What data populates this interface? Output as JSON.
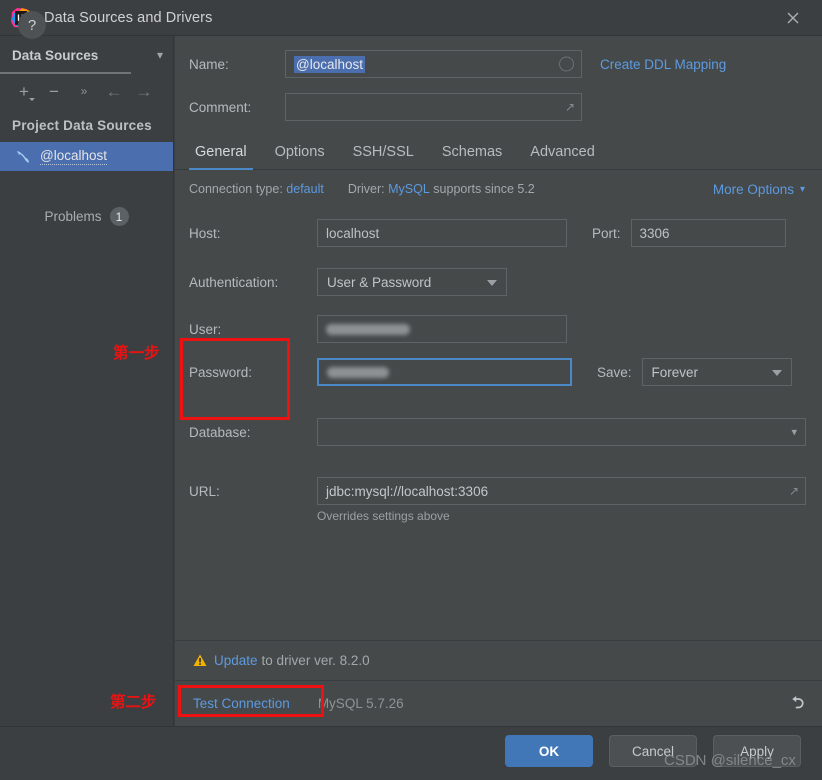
{
  "window": {
    "title": "Data Sources and Drivers",
    "app_icon": "intellij-idea-icon",
    "close_icon": "close-icon"
  },
  "sidebar": {
    "header": {
      "label": "Data Sources",
      "chevron_icon": "chevron-down-icon"
    },
    "toolbar": [
      {
        "name": "add-button",
        "glyph": "+"
      },
      {
        "name": "remove-button",
        "glyph": "−"
      },
      {
        "name": "more-button",
        "glyph": "»"
      },
      {
        "name": "back-button",
        "glyph": "←"
      },
      {
        "name": "forward-button",
        "glyph": "→"
      }
    ],
    "group_title": "Project Data Sources",
    "items": [
      {
        "label": "@localhost",
        "icon": "mysql-dolphin-icon",
        "selected": true
      }
    ],
    "problems": {
      "label": "Problems",
      "count": "1"
    }
  },
  "form": {
    "name": {
      "label": "Name:",
      "value": "@localhost"
    },
    "create_ddl_mapping": "Create DDL Mapping",
    "comment": {
      "label": "Comment:",
      "value": ""
    },
    "tabs": [
      {
        "label": "General",
        "active": true
      },
      {
        "label": "Options",
        "active": false
      },
      {
        "label": "SSH/SSL",
        "active": false
      },
      {
        "label": "Schemas",
        "active": false
      },
      {
        "label": "Advanced",
        "active": false
      }
    ],
    "connection_type": {
      "label": "Connection type:",
      "value": "default"
    },
    "driver": {
      "label": "Driver:",
      "value": "MySQL",
      "note": "supports since 5.2"
    },
    "more_options": {
      "label": "More Options",
      "chevron_icon": "chevron-down-icon"
    },
    "host": {
      "label": "Host:",
      "value": "localhost"
    },
    "port": {
      "label": "Port:",
      "value": "3306"
    },
    "authentication": {
      "label": "Authentication:",
      "value": "User & Password"
    },
    "user": {
      "label": "User:",
      "value": "",
      "redacted": true
    },
    "password": {
      "label": "Password:",
      "value": "",
      "redacted": true,
      "focused": true
    },
    "save": {
      "label": "Save:",
      "value": "Forever"
    },
    "database": {
      "label": "Database:",
      "value": ""
    },
    "url": {
      "label": "URL:",
      "value": "jdbc:mysql://localhost:3306",
      "hint": "Overrides settings above"
    }
  },
  "status": {
    "warning_icon": "warning-triangle-icon",
    "update_link": "Update",
    "update_rest": " to driver ver. 8.2.0",
    "test_connection": "Test Connection",
    "driver_version": "MySQL 5.7.26",
    "revert_icon": "revert-icon"
  },
  "footer": {
    "help_icon": "help-icon",
    "ok": "OK",
    "cancel": "Cancel",
    "apply": "Apply"
  },
  "annotations": [
    {
      "name": "step-one",
      "text": "第一步",
      "color": "#ee1111"
    },
    {
      "name": "step-two",
      "text": "第二步",
      "color": "#ee1111"
    }
  ],
  "watermark": "CSDN @silence_cx"
}
